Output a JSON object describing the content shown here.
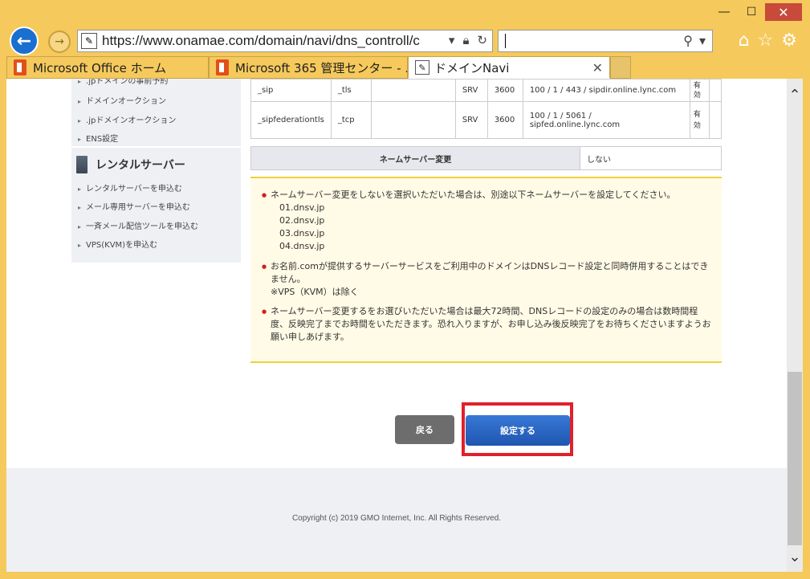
{
  "browser": {
    "url": "https://www.onamae.com/domain/navi/dns_controll/c",
    "search_value": "",
    "tabs": [
      {
        "label": "Microsoft Office ホーム"
      },
      {
        "label": "Microsoft 365 管理センター - ..."
      },
      {
        "label": "ドメインNavi"
      }
    ]
  },
  "sidebar": {
    "links_top": [
      ".jpドメインの事前予約",
      "ドメインオークション",
      ".jpドメインオークション",
      "ENS設定"
    ],
    "heading": "レンタルサーバー",
    "links_bottom": [
      "レンタルサーバーを申込む",
      "メール専用サーバーを申込む",
      "一斉メール配信ツールを申込む",
      "VPS(KVM)を申込む"
    ]
  },
  "dns_rows": [
    {
      "service": "_sip",
      "protocol": "_tls",
      "name": "",
      "type": "SRV",
      "ttl": "3600",
      "value": "100 / 1 / 443 / sipdir.online.lync.com",
      "status": "有効"
    },
    {
      "service": "_sipfederationtls",
      "protocol": "_tcp",
      "name": "",
      "type": "SRV",
      "ttl": "3600",
      "value": "100 / 1 / 5061 / sipfed.online.lync.com",
      "status": "有効"
    }
  ],
  "nameserver": {
    "label": "ネームサーバー変更",
    "value": "しない"
  },
  "notice": {
    "item1": "ネームサーバー変更をしないを選択いただいた場合は、別途以下ネームサーバーを設定してください。",
    "nameservers": [
      "01.dnsv.jp",
      "02.dnsv.jp",
      "03.dnsv.jp",
      "04.dnsv.jp"
    ],
    "item2": "お名前.comが提供するサーバーサービスをご利用中のドメインはDNSレコード設定と同時併用することはできません。",
    "item2_note": "※VPS（KVM）は除く",
    "item3": "ネームサーバー変更するをお選びいただいた場合は最大72時間、DNSレコードの設定のみの場合は数時間程度、反映完了までお時間をいただきます。恐れ入りますが、お申し込み後反映完了をお待ちくださいますようお願い申しあげます。"
  },
  "buttons": {
    "back": "戻る",
    "submit": "設定する"
  },
  "footer": {
    "copyright": "Copyright (c) 2019 GMO Internet, Inc. All Rights Reserved."
  },
  "colors": {
    "accent_blue": "#1e56b0",
    "highlight_red": "#e0202a",
    "notice_bg": "#fffbe6",
    "notice_border": "#f0d13a"
  }
}
